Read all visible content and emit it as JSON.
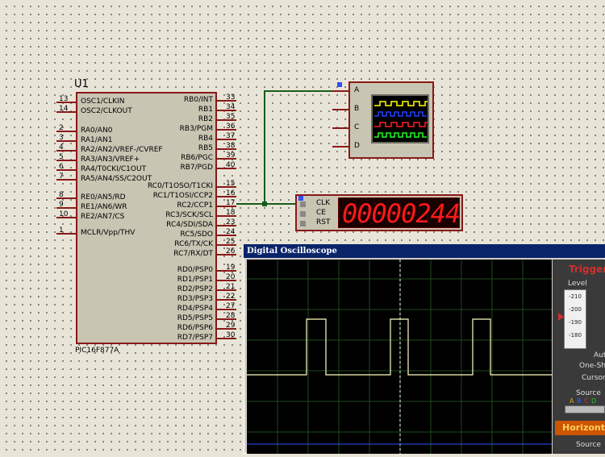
{
  "chip": {
    "ref": "U1",
    "part": "PIC16F877A",
    "left_pins": [
      {
        "num": "13",
        "name": "OSC1/CLKIN"
      },
      {
        "num": "14",
        "name": "OSC2/CLKOUT"
      },
      {
        "num": "2",
        "name": "RA0/AN0"
      },
      {
        "num": "3",
        "name": "RA1/AN1"
      },
      {
        "num": "4",
        "name": "RA2/AN2/VREF-/CVREF"
      },
      {
        "num": "5",
        "name": "RA3/AN3/VREF+"
      },
      {
        "num": "6",
        "name": "RA4/T0CKI/C1OUT"
      },
      {
        "num": "7",
        "name": "RA5/AN4/SS/C2OUT"
      },
      {
        "num": "8",
        "name": "RE0/AN5/RD"
      },
      {
        "num": "9",
        "name": "RE1/AN6/WR"
      },
      {
        "num": "10",
        "name": "RE2/AN7/CS"
      },
      {
        "num": "1",
        "name": "MCLR/Vpp/THV"
      }
    ],
    "right_pins": [
      {
        "num": "33",
        "name": "RB0/INT"
      },
      {
        "num": "34",
        "name": "RB1"
      },
      {
        "num": "35",
        "name": "RB2"
      },
      {
        "num": "36",
        "name": "RB3/PGM"
      },
      {
        "num": "37",
        "name": "RB4"
      },
      {
        "num": "38",
        "name": "RB5"
      },
      {
        "num": "39",
        "name": "RB6/PGC"
      },
      {
        "num": "40",
        "name": "RB7/PGD"
      },
      {
        "num": "15",
        "name": "RC0/T1OSO/T1CKI"
      },
      {
        "num": "16",
        "name": "RC1/T1OSI/CCP2"
      },
      {
        "num": "17",
        "name": "RC2/CCP1"
      },
      {
        "num": "18",
        "name": "RC3/SCK/SCL"
      },
      {
        "num": "23",
        "name": "RC4/SDI/SDA"
      },
      {
        "num": "24",
        "name": "RC5/SDO"
      },
      {
        "num": "25",
        "name": "RC6/TX/CK"
      },
      {
        "num": "26",
        "name": "RC7/RX/DT"
      },
      {
        "num": "19",
        "name": "RD0/PSP0"
      },
      {
        "num": "20",
        "name": "RD1/PSP1"
      },
      {
        "num": "21",
        "name": "RD2/PSP2"
      },
      {
        "num": "22",
        "name": "RD3/PSP3"
      },
      {
        "num": "27",
        "name": "RD4/PSP4"
      },
      {
        "num": "28",
        "name": "RD5/PSP5"
      },
      {
        "num": "29",
        "name": "RD6/PSP6"
      },
      {
        "num": "30",
        "name": "RD7/PSP7"
      }
    ]
  },
  "oscilloscope_instrument": {
    "channels": [
      "A",
      "B",
      "C",
      "D"
    ],
    "trace_colors": [
      "#ffff00",
      "#2040ff",
      "#ff2020",
      "#20ff20"
    ]
  },
  "counter": {
    "pins": [
      "CLK",
      "CE",
      "RST"
    ],
    "display": "00000244"
  },
  "scope_window": {
    "title": "Digital Oscilloscope",
    "trace_color": "#ffffc0",
    "trigger": {
      "title": "Trigger",
      "level_label": "Level",
      "level_ticks": [
        "-210",
        "-200",
        "-190",
        "-180"
      ],
      "auto_label": "Auto",
      "oneshot_label": "One-Shot",
      "cursors_label": "Cursors",
      "source_label": "Source",
      "source_letters": [
        "A",
        "B",
        "C",
        "D"
      ]
    },
    "horizontal": {
      "title": "Horizontal",
      "source_label": "Source"
    }
  },
  "colors": {
    "wire": "#1a5c1a",
    "component_outline": "#8a1818",
    "component_fill": "#c9c5b3"
  }
}
